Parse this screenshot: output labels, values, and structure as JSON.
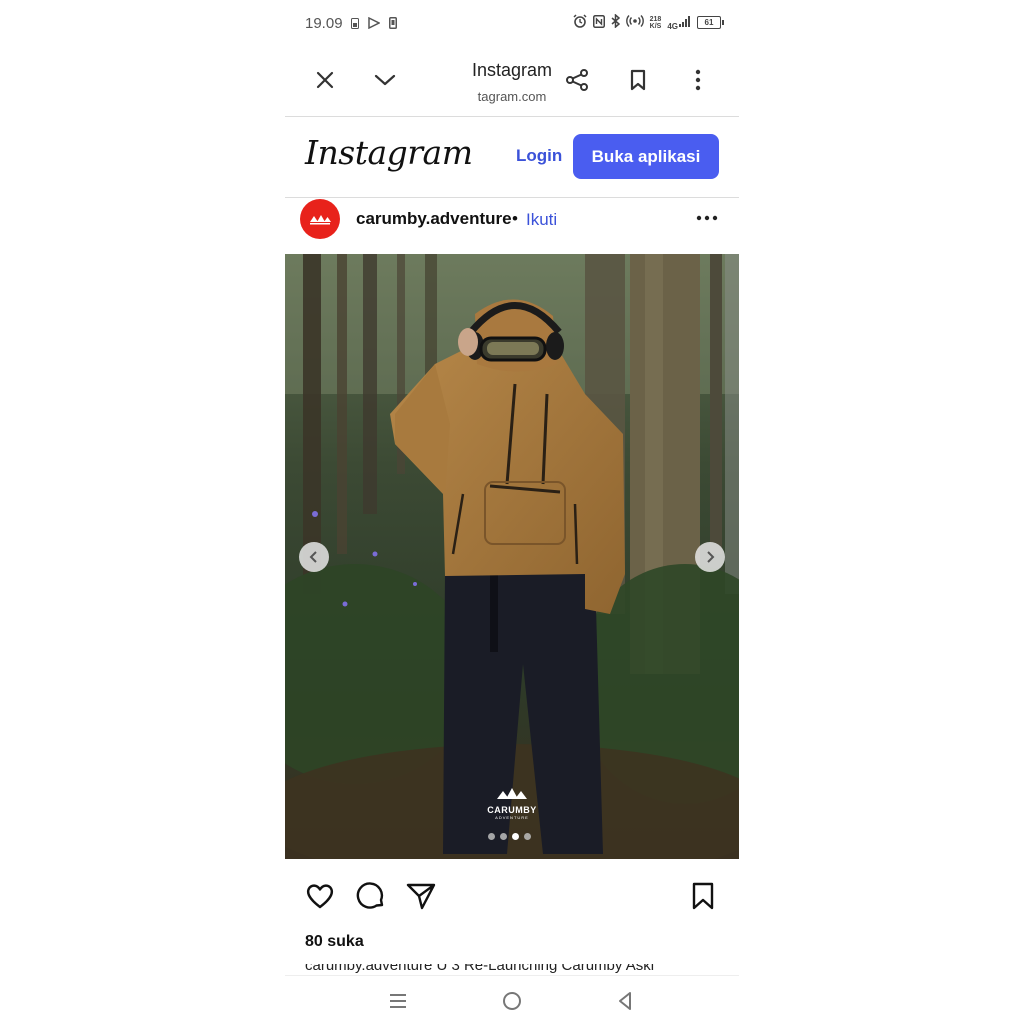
{
  "status_bar": {
    "time": "19.09",
    "speed_value": "218",
    "speed_unit": "K/S",
    "network": "4G",
    "battery": "61"
  },
  "browser": {
    "title": "Instagram",
    "url": "tagram.com",
    "icons": [
      "close-icon",
      "chevron-down-icon",
      "share-icon",
      "bookmark-icon",
      "more-vertical-icon"
    ]
  },
  "ig_header": {
    "logo": "Instagram",
    "login_label": "Login",
    "open_app_label": "Buka aplikasi"
  },
  "post": {
    "username": "carumby.adventure",
    "separator": "•",
    "follow_label": "Ikuti",
    "brand_overlay": "CARUMBY",
    "brand_overlay_sub": "ADVENTURE",
    "carousel": {
      "total": 4,
      "active_index": 2
    },
    "likes": "80 suka",
    "caption": "carumby.adventure U 3 Re-Launching Carumby Aski"
  },
  "colors": {
    "accent": "#4a5df0",
    "link": "#3b52d9",
    "avatar": "#e8221b"
  },
  "nav_bar": {
    "icons": [
      "menu-icon",
      "home-circle-icon",
      "back-triangle-icon"
    ]
  }
}
